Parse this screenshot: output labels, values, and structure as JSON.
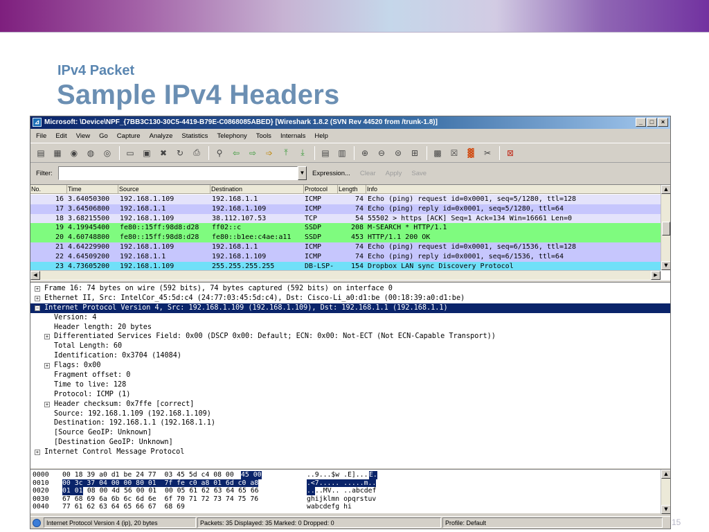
{
  "slide": {
    "subtitle": "IPv4 Packet",
    "title": "Sample IPv4 Headers",
    "page_number": "15"
  },
  "window": {
    "title": "Microsoft: \\Device\\NPF_{7BB3C130-30C5-4419-B79E-C0868085ABED}  [Wireshark 1.8.2  (SVN Rev 44520 from /trunk-1.8)]",
    "buttons": [
      "_",
      "□",
      "×"
    ]
  },
  "menu": [
    "File",
    "Edit",
    "View",
    "Go",
    "Capture",
    "Analyze",
    "Statistics",
    "Telephony",
    "Tools",
    "Internals",
    "Help"
  ],
  "toolbar_icons": [
    "interface-list-icon",
    "capture-options-icon",
    "start-capture-icon",
    "stop-capture-icon",
    "restart-capture-icon",
    "open-file-icon",
    "save-file-icon",
    "close-file-icon",
    "reload-icon",
    "print-icon",
    "find-packet-icon",
    "go-back-icon",
    "go-forward-icon",
    "go-to-packet-icon",
    "go-first-icon",
    "go-last-icon",
    "colorize-icon",
    "auto-scroll-icon",
    "zoom-in-icon",
    "zoom-out-icon",
    "normal-size-icon",
    "resize-columns-icon",
    "capture-filters-icon",
    "display-filters-icon",
    "coloring-rules-icon",
    "preferences-icon",
    "help-icon"
  ],
  "filter": {
    "label": "Filter:",
    "value": "",
    "expression": "Expression...",
    "clear": "Clear",
    "apply": "Apply",
    "save": "Save"
  },
  "packet_list": {
    "columns": [
      "No.",
      "Time",
      "Source",
      "Destination",
      "Protocol",
      "Length",
      "Info"
    ],
    "rows": [
      {
        "no": "16",
        "time": "3.64050300",
        "src": "192.168.1.109",
        "dst": "192.168.1.1",
        "proto": "ICMP",
        "len": "74",
        "info": "Echo (ping) request  id=0x0001, seq=5/1280, ttl=128",
        "color": "#e4e3fb"
      },
      {
        "no": "17",
        "time": "3.64506800",
        "src": "192.168.1.1",
        "dst": "192.168.1.109",
        "proto": "ICMP",
        "len": "74",
        "info": "Echo (ping) reply    id=0x0001, seq=5/1280, ttl=64",
        "color": "#c6c6fd"
      },
      {
        "no": "18",
        "time": "3.68215500",
        "src": "192.168.1.109",
        "dst": "38.112.107.53",
        "proto": "TCP",
        "len": "54",
        "info": "55502 > https [ACK] Seq=1 Ack=134 Win=16661 Len=0",
        "color": "#e4e3fb"
      },
      {
        "no": "19",
        "time": "4.19945400",
        "src": "fe80::15ff:98d8:d28",
        "dst": "ff02::c",
        "proto": "SSDP",
        "len": "208",
        "info": "M-SEARCH * HTTP/1.1",
        "color": "#7ffb7f"
      },
      {
        "no": "20",
        "time": "4.60748800",
        "src": "fe80::15ff:98d8:d28",
        "dst": "fe80::b1ee:c4ae:a11",
        "proto": "SSDP",
        "len": "453",
        "info": "HTTP/1.1 200 OK",
        "color": "#7ffb7f"
      },
      {
        "no": "21",
        "time": "4.64229900",
        "src": "192.168.1.109",
        "dst": "192.168.1.1",
        "proto": "ICMP",
        "len": "74",
        "info": "Echo (ping) request  id=0x0001, seq=6/1536, ttl=128",
        "color": "#c6c6fd"
      },
      {
        "no": "22",
        "time": "4.64509200",
        "src": "192.168.1.1",
        "dst": "192.168.1.109",
        "proto": "ICMP",
        "len": "74",
        "info": "Echo (ping) reply    id=0x0001, seq=6/1536, ttl=64",
        "color": "#c6c6fd"
      },
      {
        "no": "23",
        "time": "4.73605200",
        "src": "192.168.1.109",
        "dst": "255.255.255.255",
        "proto": "DB-LSP-",
        "len": "154",
        "info": "Dropbox LAN sync Discovery Protocol",
        "color": "#70e0f8"
      }
    ]
  },
  "details": [
    {
      "indent": 0,
      "toggle": "+",
      "text": "Frame 16: 74 bytes on wire (592 bits), 74 bytes captured (592 bits) on interface 0",
      "selected": false
    },
    {
      "indent": 0,
      "toggle": "+",
      "text": "Ethernet II, Src: IntelCor_45:5d:c4 (24:77:03:45:5d:c4), Dst: Cisco-Li_a0:d1:be (00:18:39:a0:d1:be)",
      "selected": false
    },
    {
      "indent": 0,
      "toggle": "−",
      "text": "Internet Protocol Version 4, Src: 192.168.1.109 (192.168.1.109), Dst: 192.168.1.1 (192.168.1.1)",
      "selected": true
    },
    {
      "indent": 1,
      "toggle": "",
      "text": "Version: 4",
      "selected": false
    },
    {
      "indent": 1,
      "toggle": "",
      "text": "Header length: 20 bytes",
      "selected": false
    },
    {
      "indent": 1,
      "toggle": "+",
      "text": "Differentiated Services Field: 0x00 (DSCP 0x00: Default; ECN: 0x00: Not-ECT (Not ECN-Capable Transport))",
      "selected": false
    },
    {
      "indent": 1,
      "toggle": "",
      "text": "Total Length: 60",
      "selected": false
    },
    {
      "indent": 1,
      "toggle": "",
      "text": "Identification: 0x3704 (14084)",
      "selected": false
    },
    {
      "indent": 1,
      "toggle": "+",
      "text": "Flags: 0x00",
      "selected": false
    },
    {
      "indent": 1,
      "toggle": "",
      "text": "Fragment offset: 0",
      "selected": false
    },
    {
      "indent": 1,
      "toggle": "",
      "text": "Time to live: 128",
      "selected": false
    },
    {
      "indent": 1,
      "toggle": "",
      "text": "Protocol: ICMP (1)",
      "selected": false
    },
    {
      "indent": 1,
      "toggle": "+",
      "text": "Header checksum: 0x7ffe [correct]",
      "selected": false
    },
    {
      "indent": 1,
      "toggle": "",
      "text": "Source: 192.168.1.109 (192.168.1.109)",
      "selected": false
    },
    {
      "indent": 1,
      "toggle": "",
      "text": "Destination: 192.168.1.1 (192.168.1.1)",
      "selected": false
    },
    {
      "indent": 1,
      "toggle": "",
      "text": "[Source GeoIP: Unknown]",
      "selected": false
    },
    {
      "indent": 1,
      "toggle": "",
      "text": "[Destination GeoIP: Unknown]",
      "selected": false
    },
    {
      "indent": 0,
      "toggle": "+",
      "text": "Internet Control Message Protocol",
      "selected": false
    }
  ],
  "bytes": [
    {
      "offset": "0000",
      "hex_a": "00 18 39 a0 d1 be 24 77  03 45 5d c4 08 00",
      "hex_hl": "45 00",
      "hex_b": "",
      "ascii_a": "..9...$w .E]...",
      "ascii_hl": "E.",
      "ascii_b": ""
    },
    {
      "offset": "0010",
      "hex_a": "",
      "hex_hl": "00 3c 37 04 00 00 80 01  7f fe c0 a8 01 6d c0 a8",
      "hex_b": "",
      "ascii_a": "",
      "ascii_hl": ".<7..... .....m..",
      "ascii_b": ""
    },
    {
      "offset": "0020",
      "hex_a": "",
      "hex_hl": "01 01",
      "hex_b": " 08 00 4d 56 00 01  00 05 61 62 63 64 65 66",
      "ascii_a": "",
      "ascii_hl": "..",
      "ascii_b": "..MV.. ..abcdef"
    },
    {
      "offset": "0030",
      "hex_a": "67 68 69 6a 6b 6c 6d 6e  6f 70 71 72 73 74 75 76",
      "hex_hl": "",
      "hex_b": "",
      "ascii_a": "ghijklmn opqrstuv",
      "ascii_hl": "",
      "ascii_b": ""
    },
    {
      "offset": "0040",
      "hex_a": "77 61 62 63 64 65 66 67  68 69",
      "hex_hl": "",
      "hex_b": "",
      "ascii_a": "wabcdefg hi",
      "ascii_hl": "",
      "ascii_b": ""
    }
  ],
  "status": {
    "field": "Internet Protocol Version 4 (ip), 20 bytes",
    "packets": "Packets: 35 Displayed: 35 Marked: 0 Dropped: 0",
    "profile": "Profile: Default"
  }
}
